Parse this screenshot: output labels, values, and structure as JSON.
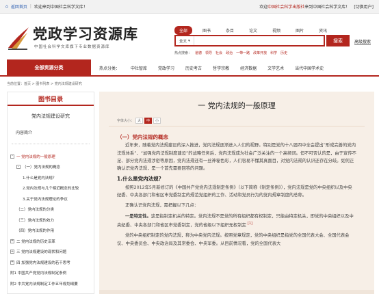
{
  "topbar": {
    "back": "返回首页",
    "welcome_left": "欢迎来到中国社会科学文库！",
    "welcome_right_prefix": "欢迎",
    "welcome_right_org": "中国社会科学出版社",
    "welcome_right_suffix": "来到中国社会科学文库！",
    "switch_user": "[切换用户]"
  },
  "logo": {
    "title": "党政学习资源库",
    "subtitle": "中国社会科学文库旗下专业数据资源库"
  },
  "search": {
    "tabs": [
      "全部",
      "图书",
      "条目",
      "论文",
      "视频",
      "图片",
      "资讯"
    ],
    "scope": "全文",
    "placeholder": "",
    "button": "搜索",
    "advanced": "高级搜索",
    "hot_label": "热点搜索：",
    "hot_words": [
      "道德",
      "领导",
      "社会",
      "政治",
      "一带一路",
      "改革开放",
      "科学",
      "历史"
    ]
  },
  "nav": {
    "all_label": "全部资源分类",
    "hot_label": "热点分类：",
    "items": [
      "中社智库",
      "党政学习",
      "历史考古",
      "哲学宗教",
      "经济数据",
      "文学艺术",
      "当代中国学术史"
    ]
  },
  "breadcrumb": "当前位置：首页 > 图书列表 > 党内法规建设研究",
  "sidebar": {
    "heading": "图书目录",
    "book_title": "党内法规建设研究",
    "intro": "内容简介",
    "toc": [
      {
        "marker": "-",
        "label": "一 党内法规的一般原理",
        "active": true,
        "indent": 0
      },
      {
        "marker": "-",
        "label": "（一）党内法规的概念",
        "active": false,
        "indent": 1
      },
      {
        "marker": "",
        "label": "1.什么是党内法规？",
        "active": false,
        "indent": 2
      },
      {
        "marker": "",
        "label": "2.党内法规与几个相近概念的比较",
        "active": false,
        "indent": 2
      },
      {
        "marker": "",
        "label": "3.关于党内法规理论的争议",
        "active": false,
        "indent": 2
      },
      {
        "marker": "",
        "label": "（二）党内法规的分类",
        "active": false,
        "indent": 1
      },
      {
        "marker": "",
        "label": "（三）党内法规的效力",
        "active": false,
        "indent": 1
      },
      {
        "marker": "",
        "label": "（四）党内法规的作用",
        "active": false,
        "indent": 1
      },
      {
        "marker": "+",
        "label": "二 党内法规的历史沿革",
        "active": false,
        "indent": 0
      },
      {
        "marker": "+",
        "label": "三 党内法规建设的现状和问题",
        "active": false,
        "indent": 0
      },
      {
        "marker": "+",
        "label": "四 加强党内法规建设的若干思考",
        "active": false,
        "indent": 0
      },
      {
        "marker": "",
        "label": "附1 中国共产党党内法规制定条例",
        "active": false,
        "indent": 0
      },
      {
        "marker": "",
        "label": "附2 中共党内法规制定工作五年规划纲要",
        "active": false,
        "indent": 0
      }
    ]
  },
  "content": {
    "chapter_title": "一 党内法规的一般原理",
    "font_size_label": "字体大小：",
    "font_sizes": [
      "大",
      "中",
      "小"
    ],
    "font_size_active": "中",
    "section1_title": "（一）党内法规的概念",
    "para1": "近年来，随着党内法规建设的深入推进，党内法规逐渐进入人们的视野。特别是党的十八届四中全会提出“形成完善的党内法规体系”、“加强党内法规制度建设”的战略任务后，党内法规成为社会广泛关注的一个高频词。但不可否认的是，由于宣传不足、部分党内法规涉密等原因，党内法规还有一丝神秘色彩，人们容易不懂其真面目，对党内法规的认识还存在分歧。如何正确认识党内法规，是一个首先需要回答的问题。",
    "subsection1_title": "1.什么是党内法规？",
    "para2": "按照2012年5月新修订的《中国共产党党内法规制定条例》（以下简称《制定条例》），党内法规是党的中央组织以及中央纪委、中央各部门和省区市党委制定的规范党组织的工作、活动和党员行为的党内规章制度的总称。",
    "para3": "正确认识党内法规，需把握以下几点：",
    "para4_lead": "一是特定性。",
    "para4": "这是指制定机关的特定。党内法规不是党的所有组织都有权制定，只能由特定机关，即党的中央组织以及中央纪委、中央各部门和省区市党委制定，党的省级以下组织无权制定",
    "para4_note": "[1]",
    "para5": "党的中央组织制定的党内法规，称为中央党内法规。按照党章规定，党的中央组织是指党的全国代表大会、全国代表会议、中央委员会、中央政治局及其常委会、中央军委。从目前情况看，党的全国代表大"
  }
}
